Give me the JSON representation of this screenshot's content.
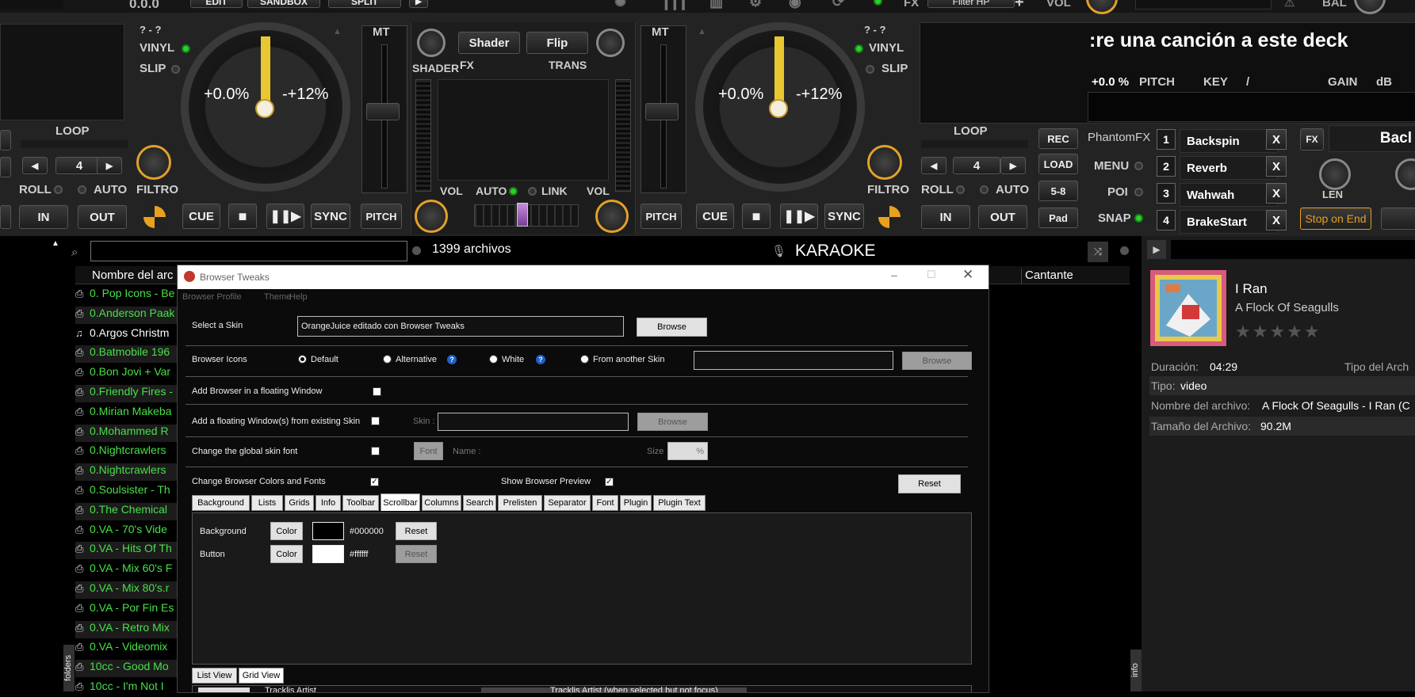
{
  "deck_top": {
    "bpm_display": "0.0.0",
    "top_buttons": [
      "EDIT",
      "SANDBOX",
      "SPLIT"
    ],
    "fx_label": "FX",
    "fx_value": "Filter HP",
    "vol_label": "VOL",
    "bal_label": "BAL"
  },
  "left_deck": {
    "question_marks": "? - ?",
    "vinyl": "VINYL",
    "slip": "SLIP",
    "pitch_value": "+0.0%",
    "pitch_range": "-+12%",
    "mt": "MT",
    "loop": "LOOP",
    "loop_value": "4",
    "roll": "ROLL",
    "auto": "AUTO",
    "filtro": "FILTRO",
    "in": "IN",
    "out": "OUT",
    "cue": "CUE",
    "sync": "SYNC",
    "pitch": "PITCH"
  },
  "mixer": {
    "shader_btn": "Shader",
    "flip_btn": "Flip",
    "shader_lbl": "SHADER",
    "fx_lbl": "FX",
    "trans_lbl": "TRANS",
    "vol_left": "VOL",
    "auto": "AUTO",
    "link": "LINK",
    "vol_right": "VOL"
  },
  "right_deck": {
    "question_marks": "? - ?",
    "vinyl": "VINYL",
    "slip": "SLIP",
    "pitch_value": "+0.0%",
    "pitch_range": "-+12%",
    "mt": "MT",
    "loop": "LOOP",
    "loop_value": "4",
    "roll": "ROLL",
    "auto": "AUTO",
    "filtro": "FILTRO",
    "in": "IN",
    "out": "OUT",
    "cue": "CUE",
    "sync": "SYNC",
    "pitch": "PITCH",
    "track_message": ":re una canción a este deck",
    "pitch_readout": "+0.0 %",
    "pitch_label": "PITCH",
    "key_label": "KEY",
    "key_sep": "/",
    "gain_label": "GAIN",
    "db_label": "dB"
  },
  "sampler": {
    "rec": "REC",
    "load": "LOAD",
    "range": "5-8",
    "pad": "Pad",
    "phantom": "PhantomFX",
    "menu": "MENU",
    "poi": "POI",
    "snap": "SNAP",
    "fx_items": [
      {
        "num": "1",
        "name": "Backspin"
      },
      {
        "num": "2",
        "name": "Reverb"
      },
      {
        "num": "3",
        "name": "Wahwah"
      },
      {
        "num": "4",
        "name": "BrakeStart"
      }
    ],
    "x_label": "X",
    "fx_btn": "FX",
    "back_label": "Bacl",
    "len_label": "LEN",
    "stop_on_end": "Stop on End"
  },
  "browser": {
    "file_count": "1399 archivos",
    "karaoke": "KARAOKE",
    "col_name": "Nombre del arc",
    "col_singer": "Cantante",
    "folders_tab": "folders",
    "info_tab": "info",
    "rows": [
      {
        "text": "0. Pop Icons - Be",
        "kind": "green"
      },
      {
        "text": "0.Anderson Paak",
        "kind": "green"
      },
      {
        "text": "0.Argos Christm",
        "kind": "white"
      },
      {
        "text": "0.Batmobile 196",
        "kind": "green"
      },
      {
        "text": "0.Bon Jovi + Var",
        "kind": "green"
      },
      {
        "text": "0.Friendly Fires -",
        "kind": "green"
      },
      {
        "text": "0.Mirian Makeba",
        "kind": "green"
      },
      {
        "text": "0.Mohammed R",
        "kind": "green"
      },
      {
        "text": "0.Nightcrawlers",
        "kind": "green"
      },
      {
        "text": "0.Nightcrawlers",
        "kind": "green"
      },
      {
        "text": "0.Soulsister - Th",
        "kind": "green"
      },
      {
        "text": "0.The Chemical",
        "kind": "green"
      },
      {
        "text": "0.VA - 70's Vide",
        "kind": "green"
      },
      {
        "text": "0.VA - Hits Of Th",
        "kind": "green"
      },
      {
        "text": "0.VA - Mix 60's F",
        "kind": "green"
      },
      {
        "text": "0.VA - Mix 80's.r",
        "kind": "green"
      },
      {
        "text": "0.VA - Por Fin Es",
        "kind": "green"
      },
      {
        "text": "0.VA - Retro Mix",
        "kind": "green"
      },
      {
        "text": "0.VA - Videomix",
        "kind": "green"
      },
      {
        "text": "10cc - Good Mo",
        "kind": "green"
      },
      {
        "text": "10cc - I'm Not I",
        "kind": "green"
      }
    ]
  },
  "info_panel": {
    "title": "I Ran",
    "artist": "A Flock Of Seagulls",
    "duration_label": "Duración:",
    "duration": "04:29",
    "type_of_label": "Tipo del Arch",
    "tipo_label": "Tipo:",
    "tipo": "video",
    "filename_label": "Nombre del archivo:",
    "filename": "A Flock Of Seagulls - I Ran (C",
    "size_label": "Tamaño del Archivo:",
    "size": "90.2M",
    "rating_stars": 0
  },
  "dialog": {
    "title": "Browser Tweaks",
    "menu": [
      "Browser Profile",
      "Theme",
      "Help"
    ],
    "select_skin_label": "Select a Skin",
    "skin_value": "OrangeJuice editado con Browser Tweaks",
    "browse": "Browse",
    "browser_icons_label": "Browser Icons",
    "icon_options": [
      "Default",
      "Alternative",
      "White",
      "From another Skin"
    ],
    "floating_label": "Add Browser in a floating Window",
    "floating_existing_label": "Add a floating Window(s) from existing Skin",
    "skin_field_label": "Skin :",
    "global_font_label": "Change the global skin font",
    "font_btn": "Font",
    "name_label": "Name :",
    "size_label": "Size",
    "size_unit": "%",
    "colors_label": "Change Browser Colors and Fonts",
    "preview_label": "Show Browser Preview",
    "reset": "Reset",
    "tabs": [
      "Background",
      "Lists",
      "Grids",
      "Info",
      "Toolbar",
      "Scrollbar",
      "Columns",
      "Search",
      "Prelisten",
      "Separator",
      "Font",
      "Plugin",
      "Plugin Text"
    ],
    "active_tab": "Scrollbar",
    "rows": [
      {
        "label": "Background",
        "color_btn": "Color",
        "hex": "#000000",
        "swatch": "#000000",
        "reset": "Reset",
        "reset_enabled": true
      },
      {
        "label": "Button",
        "color_btn": "Color",
        "hex": "#ffffff",
        "swatch": "#ffffff",
        "reset": "Reset",
        "reset_enabled": false
      }
    ],
    "view_tabs": [
      "List View",
      "Grid View"
    ],
    "active_view": "Grid View",
    "bottom_text_1": "Tracklis Artist",
    "bottom_text_2": "Tracklis Artist (when selected but not focus)"
  },
  "colors": {
    "accent_gold": "#e8c830",
    "track_green": "#47e047",
    "led_green": "#2ad12a"
  }
}
